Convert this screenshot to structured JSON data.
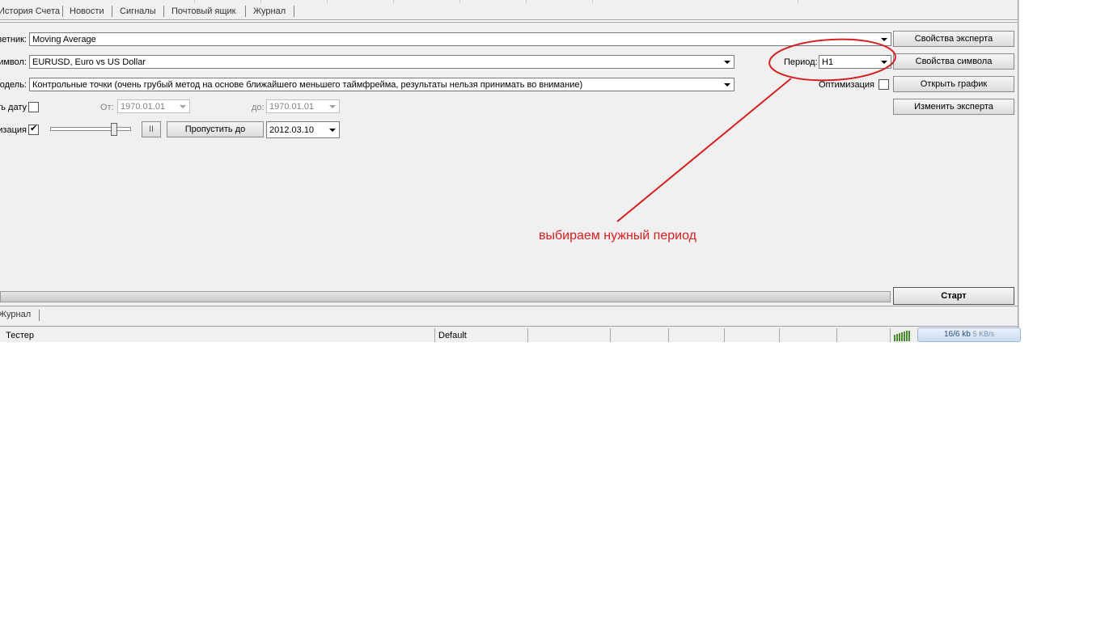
{
  "tabs": [
    "История Счета",
    "Новости",
    "Сигналы",
    "Почтовый ящик",
    "Журнал"
  ],
  "form": {
    "expert_label": "Советник:",
    "expert_value": "Moving Average",
    "symbol_label": "Символ:",
    "symbol_value": "EURUSD, Euro vs US Dollar",
    "period_label": "Период:",
    "period_value": "H1",
    "model_label": "Модель:",
    "model_value": "Контрольные точки (очень грубый метод на основе ближайшего меньшего таймфрейма, результаты нельзя принимать во внимание)",
    "optimization_label": "Оптимизация",
    "optimization_checked": false,
    "use_date_label": "Использовать дату",
    "use_date_checked": false,
    "from_label": "От:",
    "from_value": "1970.01.01",
    "to_label": "до:",
    "to_value": "1970.01.01",
    "visual_label": "Визуализация",
    "visual_checked": true,
    "visual_check_mark": "✔",
    "pause_symbol": "II",
    "skip_button": "Пропустить до",
    "skip_date": "2012.03.10"
  },
  "buttons": {
    "expert_props": "Свойства эксперта",
    "symbol_props": "Свойства символа",
    "open_chart": "Открыть график",
    "modify_expert": "Изменить эксперта",
    "start": "Старт"
  },
  "bottom_tabs": [
    "Журнал"
  ],
  "status": {
    "left": "Тестер",
    "profile": "Default",
    "traffic": "16/6 kb",
    "speed": "5 KB/s"
  },
  "annotation": {
    "text": "выбираем нужный период",
    "color": "#d42020"
  }
}
